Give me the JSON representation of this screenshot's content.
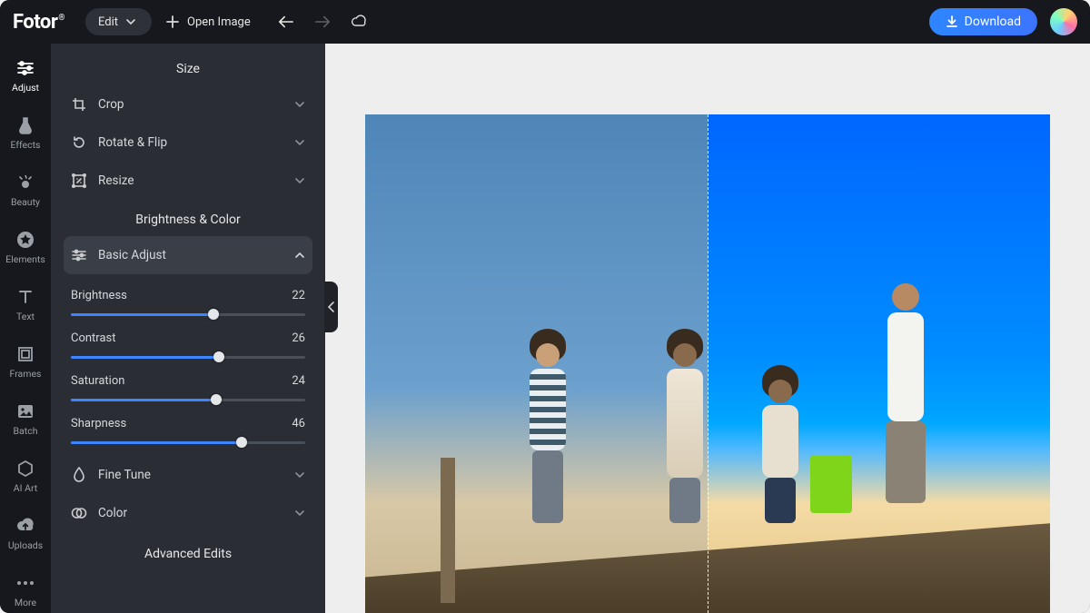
{
  "app_name": "Fotor",
  "topbar": {
    "edit_label": "Edit",
    "open_image_label": "Open Image",
    "download_label": "Download"
  },
  "rail": {
    "items": [
      {
        "label": "Adjust",
        "icon": "sliders-icon",
        "active": true
      },
      {
        "label": "Effects",
        "icon": "flask-icon",
        "active": false
      },
      {
        "label": "Beauty",
        "icon": "eye-icon",
        "active": false
      },
      {
        "label": "Elements",
        "icon": "star-badge-icon",
        "active": false
      },
      {
        "label": "Text",
        "icon": "text-icon",
        "active": false
      },
      {
        "label": "Frames",
        "icon": "frame-icon",
        "active": false
      },
      {
        "label": "Batch",
        "icon": "image-icon",
        "active": false
      },
      {
        "label": "AI Art",
        "icon": "hexagon-icon",
        "active": false
      },
      {
        "label": "Uploads",
        "icon": "cloud-up-icon",
        "active": false
      },
      {
        "label": "More",
        "icon": "dots-icon",
        "active": false
      }
    ]
  },
  "panel": {
    "sections": {
      "size_title": "Size",
      "size_items": [
        {
          "label": "Crop",
          "icon": "crop-icon"
        },
        {
          "label": "Rotate & Flip",
          "icon": "rotate-icon"
        },
        {
          "label": "Resize",
          "icon": "resize-icon"
        }
      ],
      "bc_title": "Brightness & Color",
      "basic_adjust_label": "Basic Adjust",
      "sliders": [
        {
          "label": "Brightness",
          "value": 22,
          "min": -100,
          "max": 100
        },
        {
          "label": "Contrast",
          "value": 26,
          "min": -100,
          "max": 100
        },
        {
          "label": "Saturation",
          "value": 24,
          "min": -100,
          "max": 100
        },
        {
          "label": "Sharpness",
          "value": 46,
          "min": -100,
          "max": 100
        }
      ],
      "sub_items": [
        {
          "label": "Fine Tune",
          "icon": "drop-icon"
        },
        {
          "label": "Color",
          "icon": "venn-icon"
        }
      ],
      "advanced_title": "Advanced Edits"
    }
  },
  "colors": {
    "accent": "#3d86ff",
    "bg_dark": "#17181d",
    "bg_panel": "#2a2d34"
  }
}
